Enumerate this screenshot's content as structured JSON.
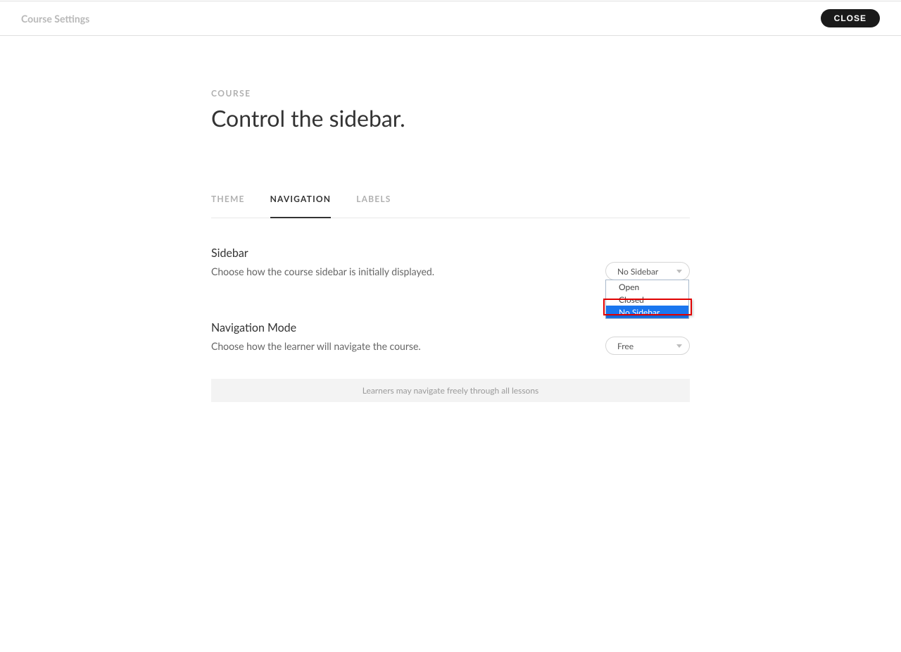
{
  "header": {
    "title": "Course Settings",
    "close": "CLOSE"
  },
  "page": {
    "eyebrow": "COURSE",
    "title": "Control the sidebar."
  },
  "tabs": [
    {
      "label": "THEME"
    },
    {
      "label": "NAVIGATION"
    },
    {
      "label": "LABELS"
    }
  ],
  "sidebar_section": {
    "title": "Sidebar",
    "desc": "Choose how the course sidebar is initially displayed.",
    "selected": "No Sidebar",
    "options": [
      "Open",
      "Closed",
      "No Sidebar"
    ]
  },
  "nav_section": {
    "title": "Navigation Mode",
    "desc": "Choose how the learner will navigate the course.",
    "selected": "Free",
    "info": "Learners may navigate freely through all lessons"
  }
}
